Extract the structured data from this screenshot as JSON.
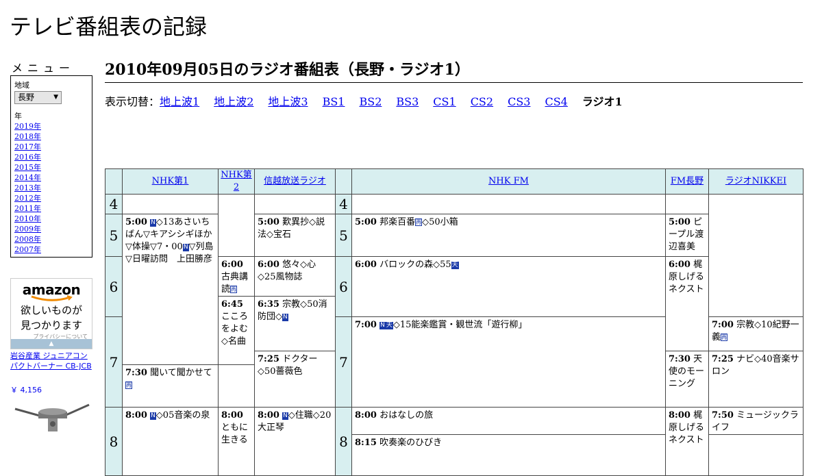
{
  "site_title": "テレビ番組表の記録",
  "menu": {
    "heading": "メニュー",
    "region_label": "地域",
    "region_value": "長野",
    "year_label": "年",
    "years": [
      "2019年",
      "2018年",
      "2017年",
      "2016年",
      "2015年",
      "2014年",
      "2013年",
      "2012年",
      "2011年",
      "2010年",
      "2009年",
      "2008年",
      "2007年"
    ]
  },
  "ad": {
    "logo": "amazon",
    "tagline_1": "欲しいものが",
    "tagline_2": "見つかります",
    "privacy": "プライバシーについて",
    "product_name": "岩谷産業 ジュニアコンパクトバーナー CB-JCB",
    "product_price": "￥ 4,156"
  },
  "page_heading": "2010年09月05日のラジオ番組表（長野・ラジオ1）",
  "switcher": {
    "label": "表示切替：",
    "links": [
      "地上波1",
      "地上波2",
      "地上波3",
      "BS1",
      "BS2",
      "BS3",
      "CS1",
      "CS2",
      "CS3",
      "CS4"
    ],
    "current": "ラジオ1"
  },
  "channels": [
    "NHK第1",
    "NHK第2",
    "信越放送ラジオ",
    "NHK FM",
    "FM長野",
    "ラジオNIKKEI"
  ],
  "hours": [
    "4",
    "5",
    "6",
    "7",
    "8"
  ],
  "marks": {
    "n": "N",
    "sai": "再",
    "ten": "天"
  },
  "programs": {
    "nhk1_500": {
      "time": "5:00",
      "a": "◇13あさいちばん▽キアシシギほか▽体操▽7・00",
      "b": "▽列島▽日曜訪問　上田勝彦"
    },
    "nhk1_800": {
      "time": "8:00",
      "a": "◇05音楽の泉"
    },
    "nhk2_600": {
      "time": "6:00",
      "a": "古典講読"
    },
    "nhk2_645": {
      "time": "6:45",
      "a": "こころをよむ◇名曲"
    },
    "nhk2_730": {
      "time": "7:30",
      "a": "聞いて聞かせて"
    },
    "nhk2_800": {
      "time": "8:00",
      "a": "ともに生きる"
    },
    "sbc_500": {
      "time": "5:00",
      "a": "歎異抄◇説法◇宝石"
    },
    "sbc_600": {
      "time": "6:00",
      "a": "悠々◇心◇25風物誌"
    },
    "sbc_635": {
      "time": "6:35",
      "a": "宗教◇50消防団◇"
    },
    "sbc_725": {
      "time": "7:25",
      "a": "ドクター◇50薔薇色"
    },
    "sbc_800": {
      "time": "8:00",
      "a": "◇住職◇20大正琴"
    },
    "fm_500": {
      "time": "5:00",
      "a": "邦楽百番",
      "b": "◇50小箱"
    },
    "fm_600": {
      "time": "6:00",
      "a": "バロックの森◇55"
    },
    "fm_700": {
      "time": "7:00",
      "a": "◇15能楽鑑賞・観世流「遊行柳」"
    },
    "fm_800": {
      "time": "8:00",
      "a": "おはなしの旅"
    },
    "fm_815": {
      "time": "8:15",
      "a": "吹奏楽のひびき"
    },
    "fmn_500": {
      "time": "5:00",
      "a": "ピープル渡辺喜美"
    },
    "fmn_600": {
      "time": "6:00",
      "a": "梶原しげるネクスト"
    },
    "fmn_730": {
      "time": "7:30",
      "a": "天使のモーニング"
    },
    "fmn_800": {
      "time": "8:00",
      "a": "梶原しげるネクスト"
    },
    "nikkei_700": {
      "time": "7:00",
      "a": "宗教◇10紀野一義"
    },
    "nikkei_725": {
      "time": "7:25",
      "a": "ナビ◇40音楽サロン"
    },
    "nikkei_750": {
      "time": "7:50",
      "a": "ミュージックライフ"
    }
  }
}
